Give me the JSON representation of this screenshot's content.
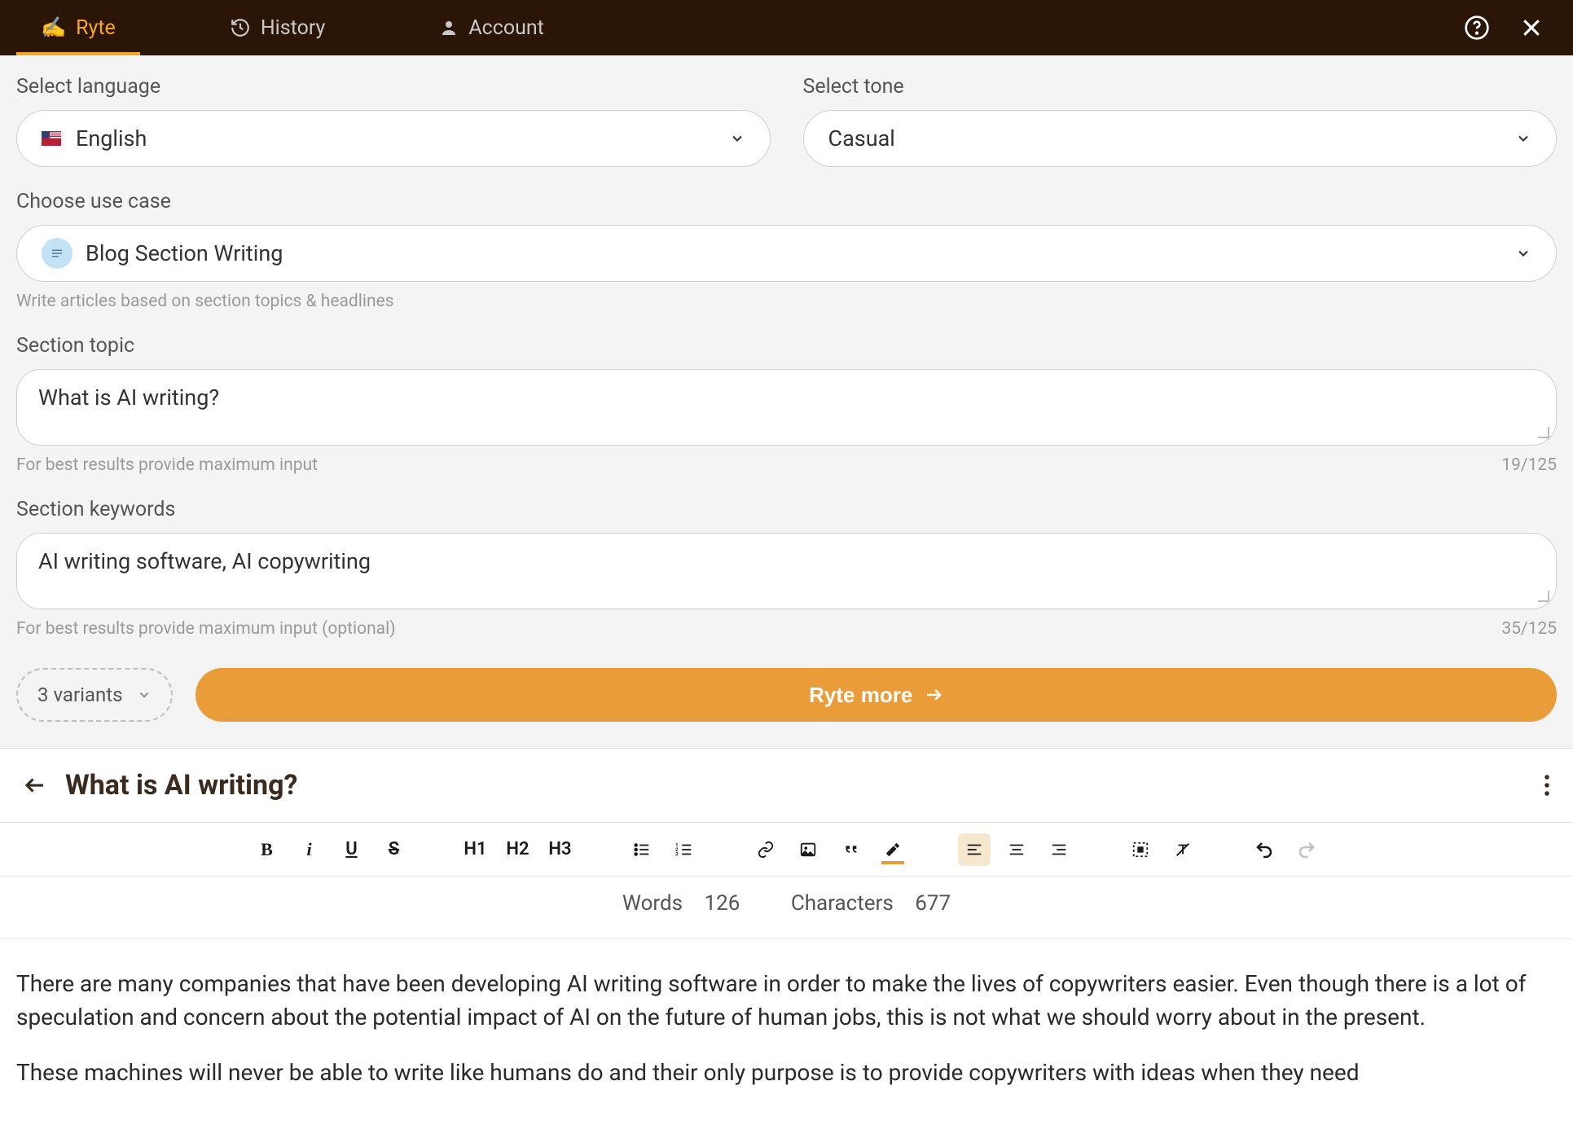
{
  "tabs": {
    "ryte": "Ryte",
    "history": "History",
    "account": "Account"
  },
  "form": {
    "language_label": "Select language",
    "language_value": "English",
    "tone_label": "Select tone",
    "tone_value": "Casual",
    "usecase_label": "Choose use case",
    "usecase_value": "Blog Section Writing",
    "usecase_helper": "Write articles based on section topics & headlines",
    "topic_label": "Section topic",
    "topic_value": "What is AI writing?",
    "topic_helper_left": "For best results provide maximum input",
    "topic_counter": "19/125",
    "keywords_label": "Section keywords",
    "keywords_value": "AI writing software, AI copywriting",
    "keywords_helper_left": "For best results provide maximum input (optional)",
    "keywords_counter": "35/125",
    "variants_label": "3 variants",
    "ryte_more": "Ryte more"
  },
  "result": {
    "title": "What is AI writing?",
    "words_label": "Words",
    "words": "126",
    "chars_label": "Characters",
    "chars": "677",
    "p1": "There are many companies that have been developing AI writing software in order to make the lives of copywriters easier. Even though there is a lot of speculation and concern about the potential impact of AI on the future of human jobs, this is not what we should worry about in the present.",
    "p2": "These machines will never be able to write like humans do and their only purpose is to provide copywriters with ideas when they need"
  },
  "toolbar": {
    "h1": "H1",
    "h2": "H2",
    "h3": "H3"
  }
}
